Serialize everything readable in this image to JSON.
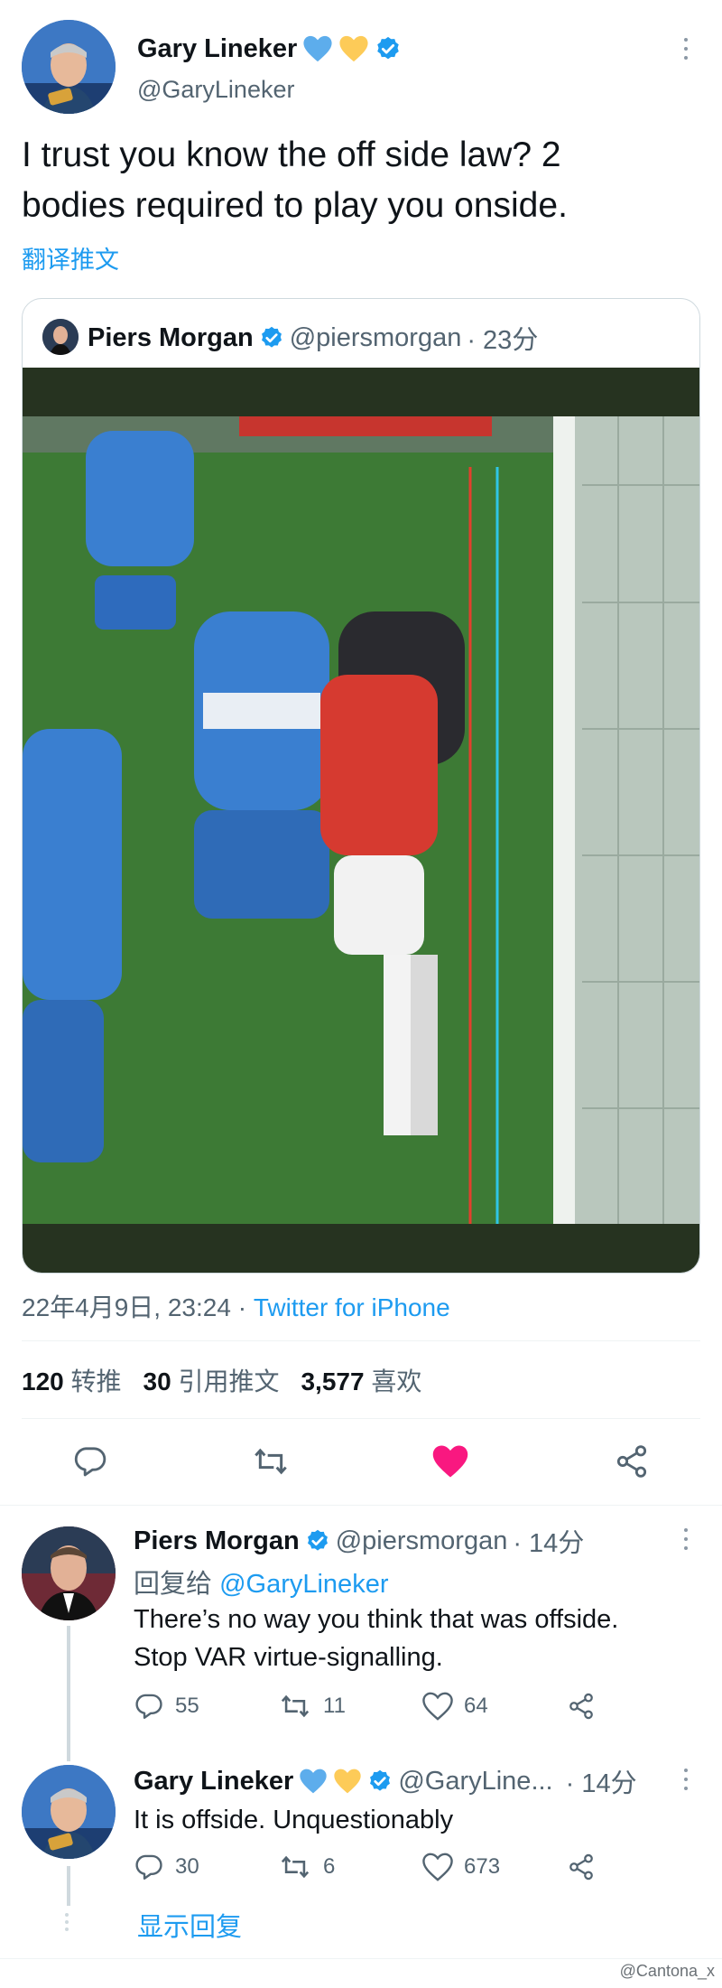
{
  "tweet": {
    "author_name": "Gary Lineker",
    "author_handle": "@GaryLineker",
    "text_line1": "I trust you know the off side law? 2",
    "text_line2": "bodies required to play you onside.",
    "translate": "翻译推文",
    "quoted": {
      "author_name": "Piers Morgan",
      "author_handle": "@piersmorgan",
      "time": "· 23分"
    },
    "timestamp": "22年4月9日, 23:24 ·",
    "source": "Twitter for iPhone",
    "stats": {
      "retweets_count": "120",
      "retweets_label": "转推",
      "quotes_count": "30",
      "quotes_label": "引用推文",
      "likes_count": "3,577",
      "likes_label": "喜欢"
    },
    "liked_color": "#f91880"
  },
  "replies": [
    {
      "author_name": "Piers Morgan",
      "author_handle": "@piersmorgan",
      "time": "· 14分",
      "replying_prefix": "回复给",
      "replying_to": "@GaryLineker",
      "text_line1": "There’s no way you think that was offside.",
      "text_line2": "Stop VAR virtue-signalling.",
      "replies_count": "55",
      "retweets_count": "11",
      "likes_count": "64"
    },
    {
      "author_name": "Gary Lineker",
      "author_handle": "@GaryLine...",
      "time": "· 14分",
      "text_line1": "It is offside. Unquestionably",
      "replies_count": "30",
      "retweets_count": "6",
      "likes_count": "673"
    }
  ],
  "show_replies": "显示回复",
  "watermark": "@Cantona_x",
  "icons": {
    "verified": "verified-badge-icon",
    "blue_heart": "blue-heart-emoji",
    "yellow_heart": "yellow-heart-emoji",
    "reply": "reply-icon",
    "retweet": "retweet-icon",
    "like": "like-icon",
    "share": "share-icon",
    "more": "more-icon"
  },
  "colors": {
    "accent": "#1d9bf0",
    "text": "#0f1419",
    "secondary": "#536471",
    "like_active": "#f91880"
  }
}
